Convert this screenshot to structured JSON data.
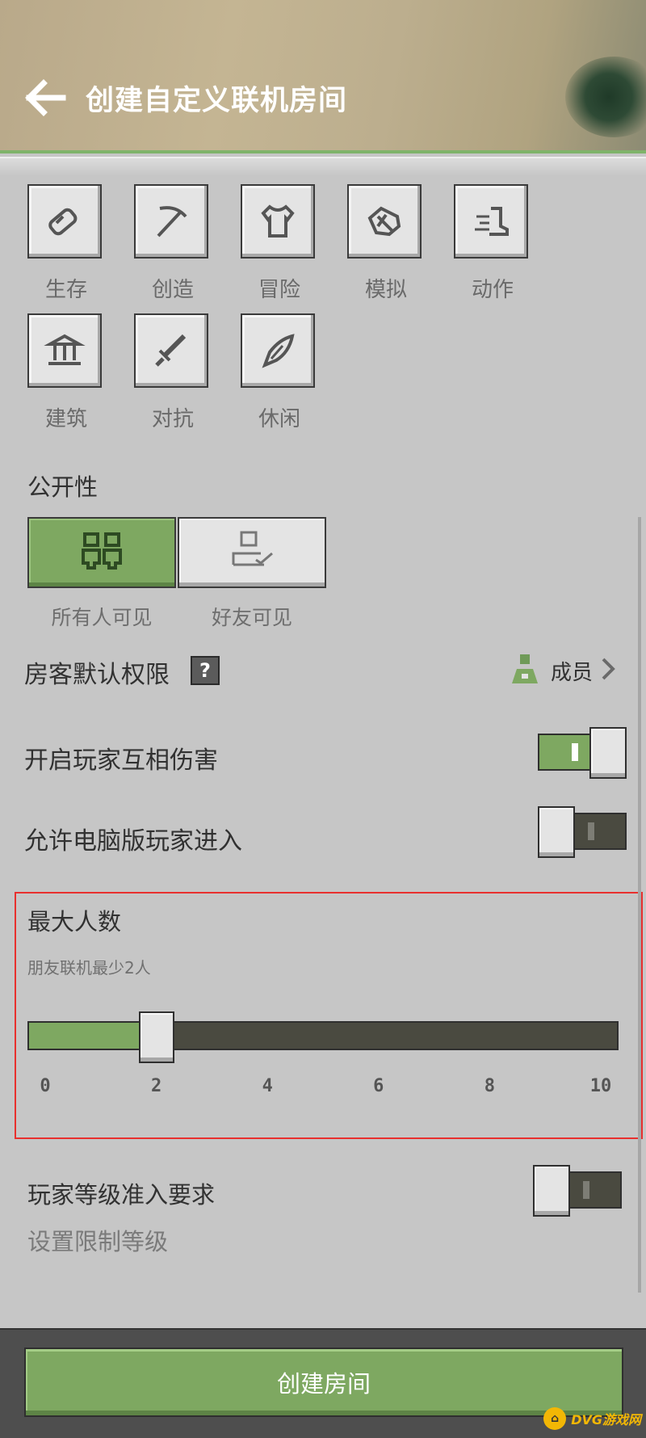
{
  "header": {
    "title": "创建自定义联机房间"
  },
  "categories": [
    {
      "label": "生存",
      "icon": "potion-icon"
    },
    {
      "label": "创造",
      "icon": "pickaxe-icon"
    },
    {
      "label": "冒险",
      "icon": "shirt-icon"
    },
    {
      "label": "模拟",
      "icon": "hand-icon"
    },
    {
      "label": "动作",
      "icon": "boot-icon"
    },
    {
      "label": "建筑",
      "icon": "building-icon"
    },
    {
      "label": "对抗",
      "icon": "sword-icon"
    },
    {
      "label": "休闲",
      "icon": "quill-icon"
    }
  ],
  "visibility": {
    "title": "公开性",
    "options": [
      {
        "label": "所有人可见",
        "selected": true,
        "icon": "group-icon"
      },
      {
        "label": "好友可见",
        "selected": false,
        "icon": "friend-check-icon"
      }
    ]
  },
  "permission": {
    "label": "房客默认权限",
    "help": "?",
    "value": "成员"
  },
  "toggles": {
    "pvp": {
      "label": "开启玩家互相伤害",
      "on": true
    },
    "pc": {
      "label": "允许电脑版玩家进入",
      "on": false
    },
    "level": {
      "label": "玩家等级准入要求",
      "sub": "设置限制等级",
      "on": false
    }
  },
  "max_players": {
    "title": "最大人数",
    "subtitle": "朋友联机最少2人",
    "value": 2,
    "min": 0,
    "max": 10,
    "ticks": [
      "0",
      "2",
      "4",
      "6",
      "8",
      "10"
    ]
  },
  "actions": {
    "create_label": "创建房间"
  },
  "watermark": {
    "text": "DVG游戏网"
  },
  "colors": {
    "accent": "#7ea861",
    "highlight": "#e8302e",
    "track_dark": "#4a4a40"
  }
}
